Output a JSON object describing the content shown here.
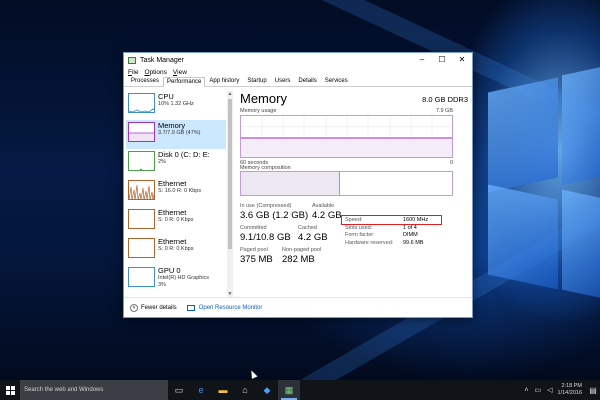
{
  "window": {
    "title": "Task Manager",
    "controls": {
      "minimize": "–",
      "maximize": "☐",
      "close": "✕"
    }
  },
  "menu": [
    "File",
    "Options",
    "View"
  ],
  "tabs": [
    "Processes",
    "Performance",
    "App history",
    "Startup",
    "Users",
    "Details",
    "Services"
  ],
  "active_tab": "Performance",
  "resources": [
    {
      "name": "CPU",
      "sub": "10% 1.32 GHz",
      "type": "cpu",
      "icon": "cpu-graph-icon"
    },
    {
      "name": "Memory",
      "sub": "3.7/7.9 GB (47%)",
      "type": "mem",
      "icon": "memory-graph-icon"
    },
    {
      "name": "Disk 0 (C: D: E:",
      "sub": "2%",
      "type": "disk",
      "icon": "disk-graph-icon"
    },
    {
      "name": "Ethernet",
      "sub": "S: 16.0 R: 0 Kbps",
      "type": "eth",
      "icon": "ethernet-graph-icon"
    },
    {
      "name": "Ethernet",
      "sub": "S: 0 R: 0 Kbps",
      "type": "eth",
      "icon": "ethernet-graph-icon"
    },
    {
      "name": "Ethernet",
      "sub": "S: 0 R: 0 Kbps",
      "type": "eth",
      "icon": "ethernet-graph-icon"
    },
    {
      "name": "GPU 0",
      "sub1": "Intel(R) HD Graphics",
      "sub2": "3%",
      "type": "gpu",
      "icon": "gpu-graph-icon"
    }
  ],
  "detail": {
    "title": "Memory",
    "total": "8.0 GB DDR3",
    "usage_label": "Memory usage",
    "usage_max": "7.9 GB",
    "axis_left": "60 seconds",
    "axis_right": "0",
    "composition_label": "Memory composition",
    "composition_used_fraction": 0.47,
    "stats": {
      "in_use_label": "In use (Compressed)",
      "in_use_value": "3.6 GB (1.2 GB)",
      "available_label": "Available",
      "available_value": "4.2 GB",
      "committed_label": "Committed",
      "committed_value": "9.1/10.8 GB",
      "cached_label": "Cached",
      "cached_value": "4.2 GB",
      "paged_label": "Paged pool",
      "paged_value": "375 MB",
      "nonpaged_label": "Non-paged pool",
      "nonpaged_value": "282 MB"
    },
    "specs": [
      {
        "k": "Speed:",
        "v": "1600 MHz"
      },
      {
        "k": "Slots used:",
        "v": "1 of 4"
      },
      {
        "k": "Form factor:",
        "v": "DIMM"
      },
      {
        "k": "Hardware reserved:",
        "v": "99.6 MB"
      }
    ]
  },
  "footer": {
    "fewer_details": "Fewer details",
    "resource_monitor": "Open Resource Monitor"
  },
  "taskbar": {
    "search_placeholder": "Search the web and Windows",
    "time": "2:18 PM",
    "date": "1/14/2016"
  },
  "colors": {
    "memory": "#9f32c4",
    "cpu": "#3c8fc7",
    "disk": "#4ca04c",
    "ethernet": "#b0632a",
    "highlight": "#e01f1f",
    "selected": "#cce8ff"
  }
}
